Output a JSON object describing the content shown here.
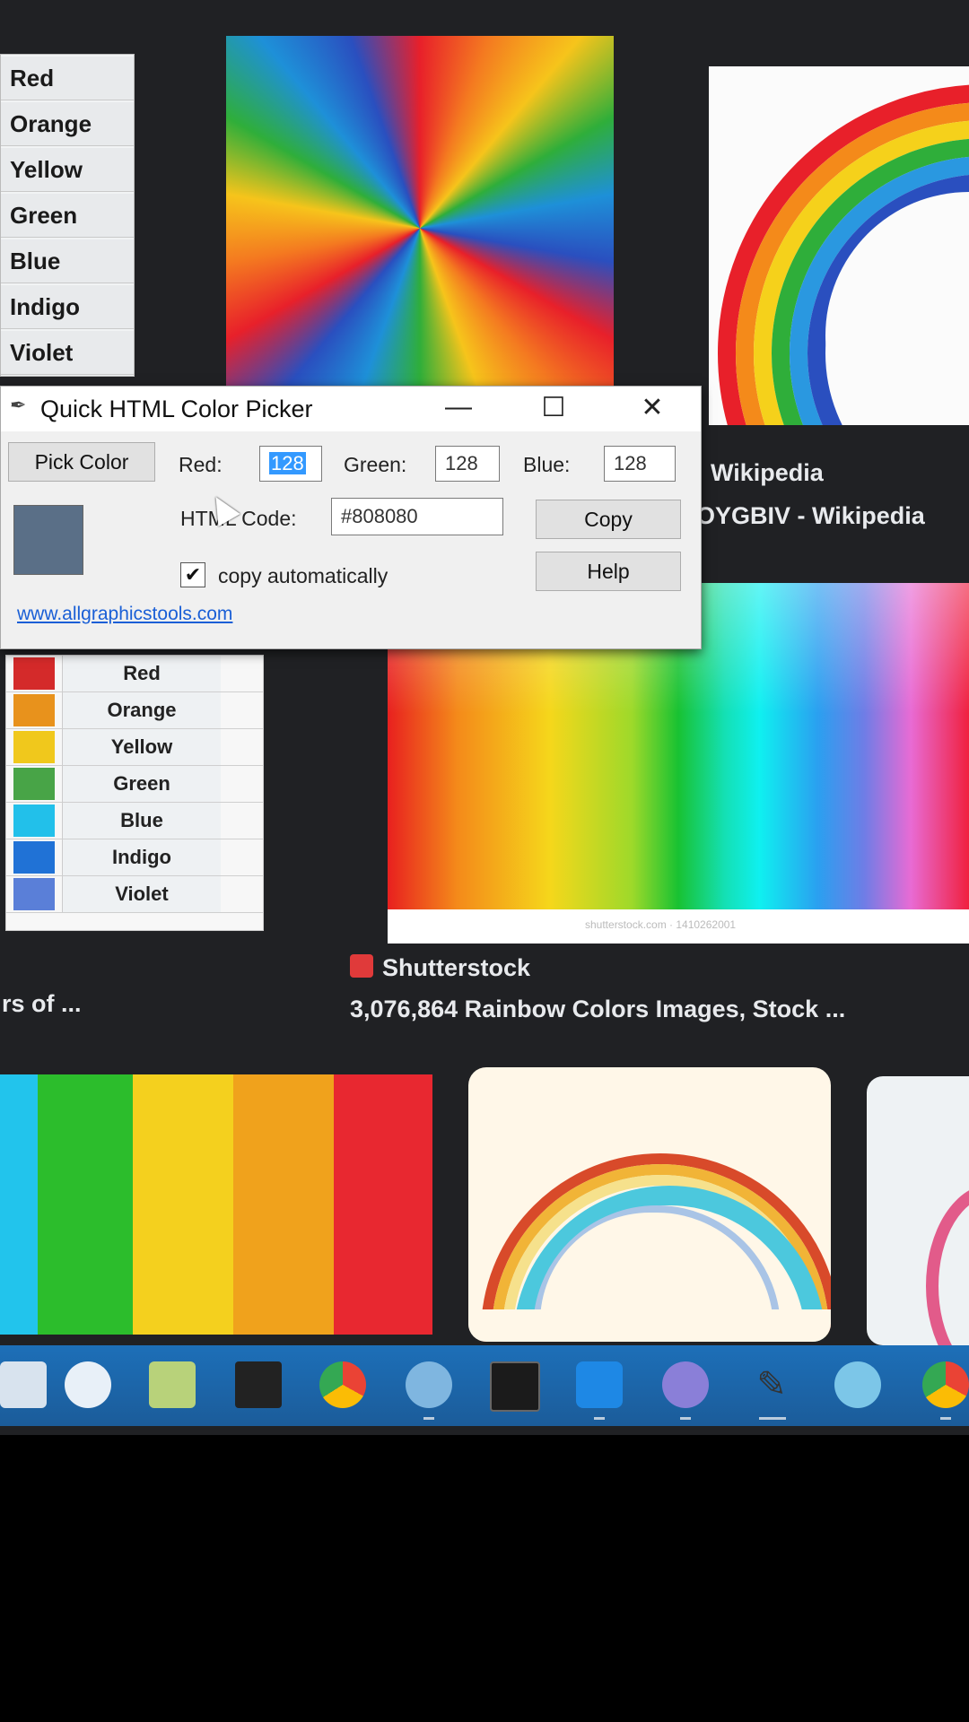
{
  "list_top": [
    "Red",
    "Orange",
    "Yellow",
    "Green",
    "Blue",
    "Indigo",
    "Violet"
  ],
  "picker": {
    "title": "Quick HTML Color Picker",
    "minimize": "—",
    "maximize": "☐",
    "close": "✕",
    "pick_button": "Pick Color",
    "red_label": "Red:",
    "red_value": "128",
    "green_label": "Green:",
    "green_value": "128",
    "blue_label": "Blue:",
    "blue_value": "128",
    "html_label": "HTML Code:",
    "html_value": "#808080",
    "copy_button": "Copy",
    "help_button": "Help",
    "copy_auto_label": "copy automatically",
    "copy_auto_checked": true,
    "link": "www.allgraphicstools.com",
    "preview_color": "#5a6f87"
  },
  "captions": {
    "wiki1": "Wikipedia",
    "wiki2": "OYGBIV - Wikipedia",
    "source": "Shutterstock",
    "title": "3,076,864 Rainbow Colors Images, Stock ...",
    "left_cut": "rs of ..."
  },
  "list2": [
    {
      "name": "Red",
      "color": "#d42a2a"
    },
    {
      "name": "Orange",
      "color": "#e8921c"
    },
    {
      "name": "Yellow",
      "color": "#f0c81c"
    },
    {
      "name": "Green",
      "color": "#48a447"
    },
    {
      "name": "Blue",
      "color": "#22c0ea"
    },
    {
      "name": "Indigo",
      "color": "#2072d6"
    },
    {
      "name": "Violet",
      "color": "#5a7fd8"
    }
  ],
  "stripes": [
    "#22c4ec",
    "#2cbd2c",
    "#f4d01e",
    "#f0a21c",
    "#e82830"
  ],
  "spectrum_watermark": "shutterstock.com · 1410262001",
  "taskbar_icons": [
    "explorer-icon",
    "word-icon",
    "notepad-icon",
    "media-icon",
    "chrome-icon",
    "dolphin-icon",
    "terminal-icon",
    "vscode-icon",
    "github-icon",
    "colorpicker-icon",
    "browser-icon",
    "chrome2-icon"
  ]
}
